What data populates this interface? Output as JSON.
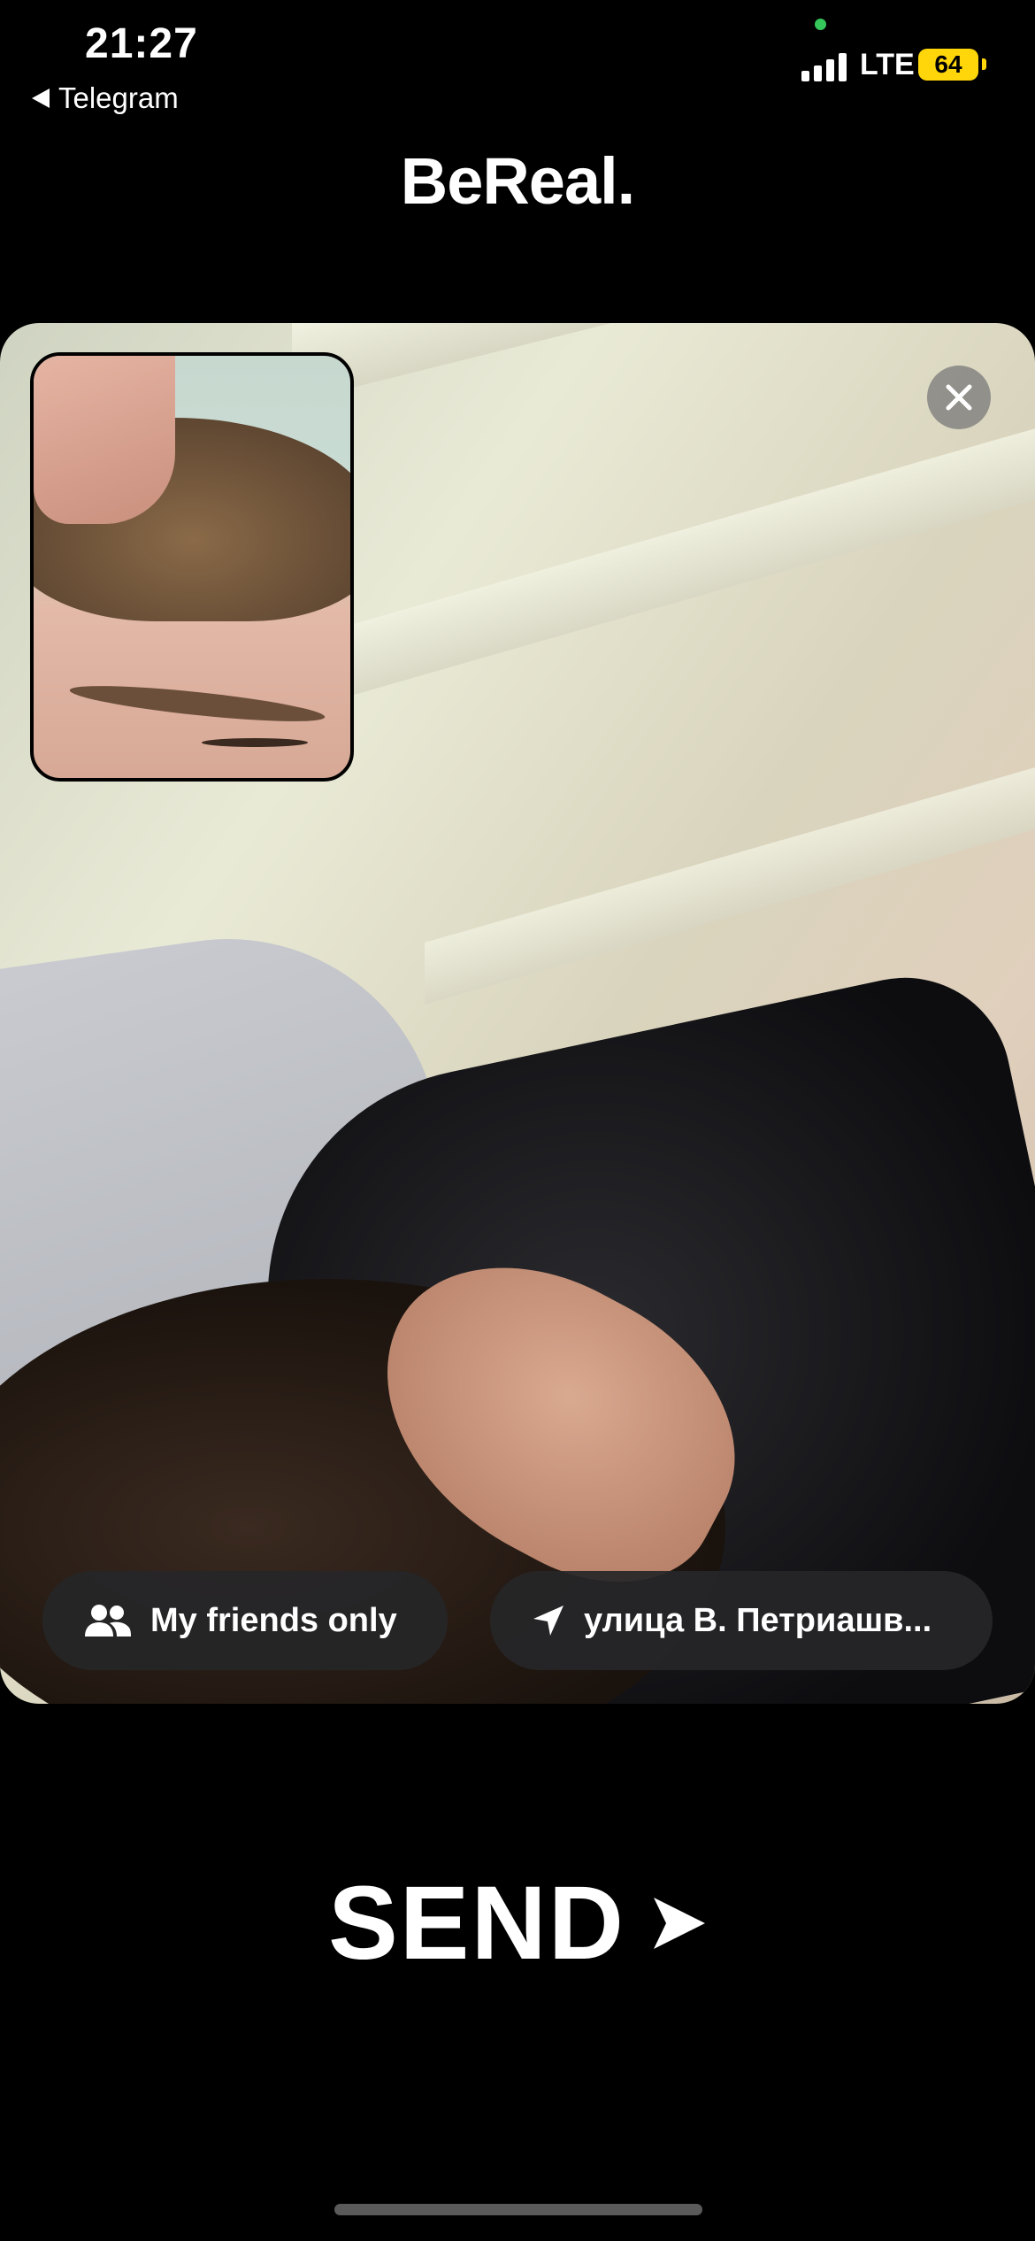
{
  "status_bar": {
    "time": "21:27",
    "back_app": "Telegram",
    "network": "LTE",
    "battery": "64"
  },
  "header": {
    "title": "BeReal."
  },
  "post": {
    "audience_label": "My friends only",
    "location_label": "улица В. Петриашв..."
  },
  "send": {
    "label": "SEND"
  },
  "colors": {
    "battery": "#ffd60a",
    "background": "#000000",
    "pill": "#262628"
  },
  "icons": {
    "close": "close-icon",
    "audience": "friends-icon",
    "location": "location-arrow-icon",
    "send": "send-arrow-icon"
  }
}
